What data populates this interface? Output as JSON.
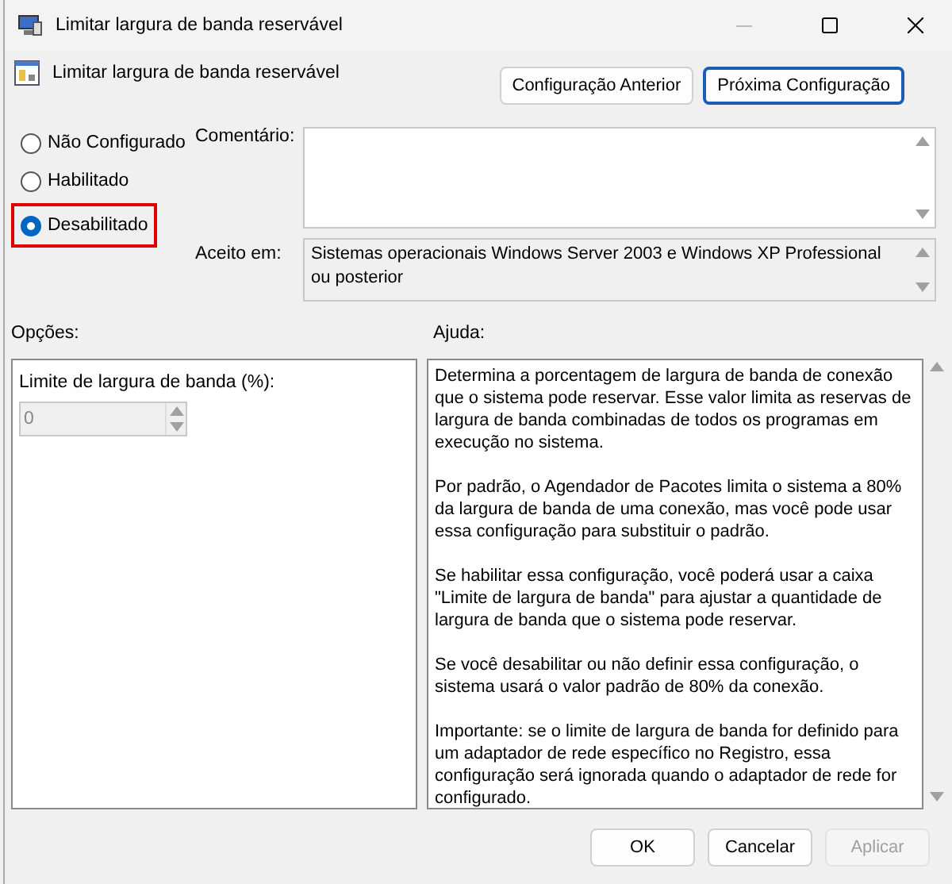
{
  "window": {
    "title": "Limitar largura de banda reservável"
  },
  "header": {
    "title": "Limitar largura de banda reservável",
    "buttons": [
      {
        "label": "Configuração Anterior",
        "focused": false
      },
      {
        "label": "Próxima Configuração",
        "focused": true
      }
    ]
  },
  "state_options": [
    {
      "label": "Não Configurado",
      "selected": false,
      "highlighted": false
    },
    {
      "label": "Habilitado",
      "selected": false,
      "highlighted": false
    },
    {
      "label": "Desabilitado",
      "selected": true,
      "highlighted": true
    }
  ],
  "comment": {
    "label": "Comentário:"
  },
  "supported_on": {
    "label": "Aceito em:",
    "value": "Sistemas operacionais Windows Server 2003 e Windows XP Professional ou posterior"
  },
  "options": {
    "label": "Opções:",
    "fields": [
      {
        "label": "Limite de largura de banda (%):",
        "value": "0",
        "disabled": true
      }
    ]
  },
  "help": {
    "label": "Ajuda:",
    "paragraphs": [
      "Determina a porcentagem de largura de banda de conexão que o sistema pode reservar. Esse valor limita as reservas de largura de banda combinadas de todos os programas em execução no sistema.",
      "Por padrão, o Agendador de Pacotes limita o sistema a 80% da largura de banda de uma conexão, mas você pode usar essa configuração para substituir o padrão.",
      "Se habilitar essa configuração, você poderá usar a caixa \"Limite de largura de banda\" para ajustar a quantidade de largura de banda que o sistema pode reservar.",
      "Se você desabilitar ou não definir essa configuração, o sistema usará o valor padrão de 80% da conexão.",
      "Importante: se o limite de largura de banda for definido para um adaptador de rede específico no Registro, essa configuração será ignorada quando o adaptador de rede for configurado."
    ]
  },
  "footer_buttons": [
    {
      "label": "OK",
      "disabled": false
    },
    {
      "label": "Cancelar",
      "disabled": false
    },
    {
      "label": "Aplicar",
      "disabled": true
    }
  ]
}
